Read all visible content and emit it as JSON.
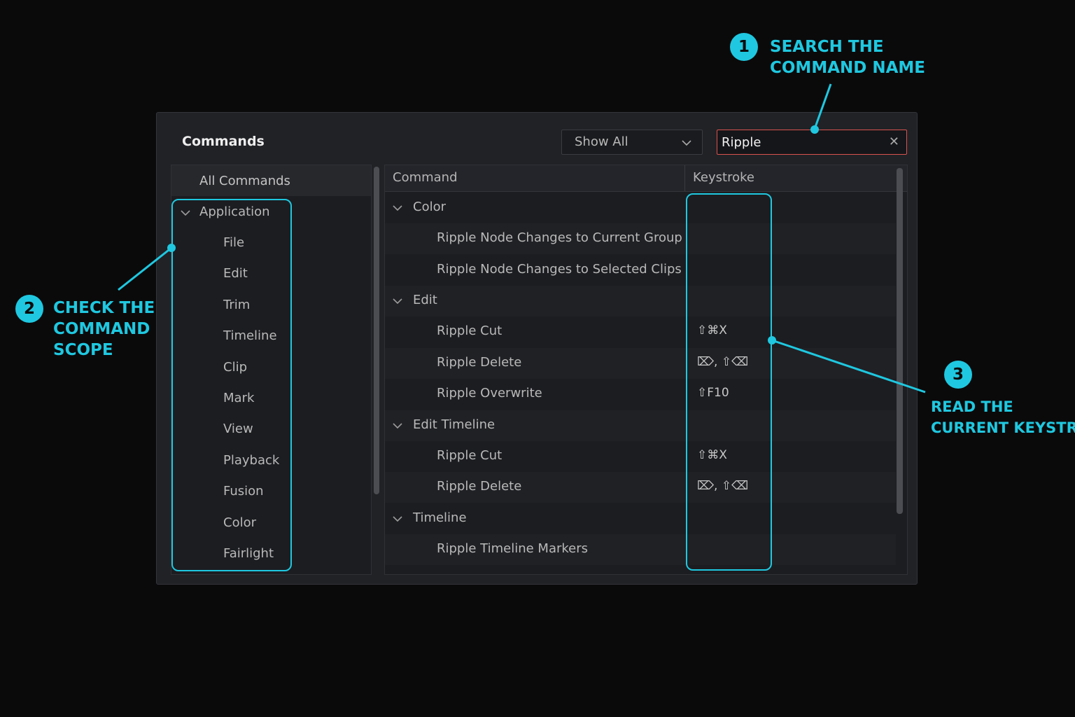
{
  "panel": {
    "title": "Commands",
    "filter_dropdown": {
      "selected": "Show All"
    },
    "search": {
      "value": "Ripple"
    }
  },
  "scope_list": {
    "all_commands": "All Commands",
    "group": "Application",
    "items": [
      "File",
      "Edit",
      "Trim",
      "Timeline",
      "Clip",
      "Mark",
      "View",
      "Playback",
      "Fusion",
      "Color",
      "Fairlight"
    ]
  },
  "command_table": {
    "headers": {
      "command": "Command",
      "keystroke": "Keystroke"
    },
    "rows": [
      {
        "type": "group",
        "label": "Color"
      },
      {
        "type": "command",
        "label": "Ripple Node Changes to Current Group",
        "keystroke": ""
      },
      {
        "type": "command",
        "label": "Ripple Node Changes to Selected Clips",
        "keystroke": ""
      },
      {
        "type": "group",
        "label": "Edit"
      },
      {
        "type": "command",
        "label": "Ripple Cut",
        "keystroke": "⇧⌘X"
      },
      {
        "type": "command",
        "label": "Ripple Delete",
        "keystroke": "⌦, ⇧⌫"
      },
      {
        "type": "command",
        "label": "Ripple Overwrite",
        "keystroke": "⇧F10"
      },
      {
        "type": "group",
        "label": "Edit Timeline"
      },
      {
        "type": "command",
        "label": "Ripple Cut",
        "keystroke": "⇧⌘X"
      },
      {
        "type": "command",
        "label": "Ripple Delete",
        "keystroke": "⌦, ⇧⌫"
      },
      {
        "type": "group",
        "label": "Timeline"
      },
      {
        "type": "command",
        "label": "Ripple Timeline Markers",
        "keystroke": ""
      }
    ]
  },
  "annotations": [
    {
      "number": "1",
      "text_line1": "SEARCH THE",
      "text_line2": "COMMAND NAME"
    },
    {
      "number": "2",
      "text_line1": "CHECK THE",
      "text_line2": "COMMAND",
      "text_line3": "SCOPE"
    },
    {
      "number": "3",
      "text_line1": "READ THE",
      "text_line2": "CURRENT KEYSTROKE"
    }
  ],
  "colors": {
    "accent": "#1fc8e0",
    "search_border": "#d9534f",
    "panel_bg": "#212226",
    "page_bg": "#0a0a0b"
  }
}
